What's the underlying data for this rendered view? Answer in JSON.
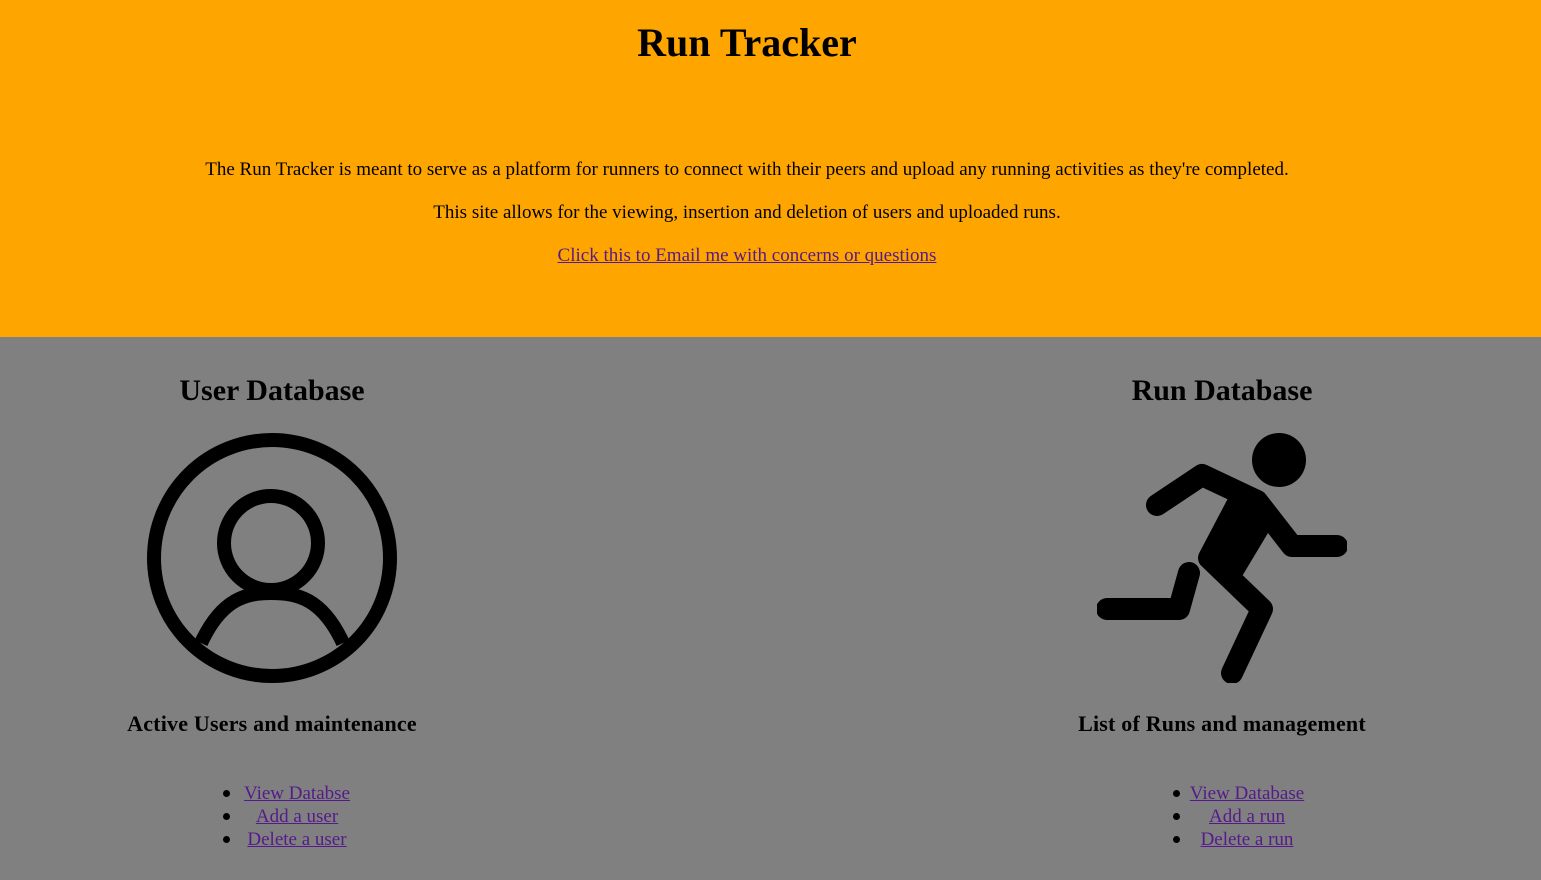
{
  "header": {
    "title": "Run Tracker",
    "description_1": "The Run Tracker is meant to serve as a platform for runners to connect with their peers and upload any running activities as they're completed.",
    "description_2": "This site allows for the viewing, insertion and deletion of users and uploaded runs.",
    "email_link": "Click this to Email me with concerns or questions",
    "background_color": "#ffa500"
  },
  "main": {
    "background_color": "#808080",
    "link_color": "#551a8b"
  },
  "user_panel": {
    "title": "User Database",
    "icon": "user-circle-icon",
    "subtitle": "Active Users and maintenance",
    "links": [
      "View Databse",
      "Add a user",
      "Delete a user"
    ]
  },
  "run_panel": {
    "title": "Run Database",
    "icon": "runner-icon",
    "subtitle": "List of Runs and management",
    "links": [
      "View Database",
      "Add a run",
      "Delete a run"
    ]
  }
}
